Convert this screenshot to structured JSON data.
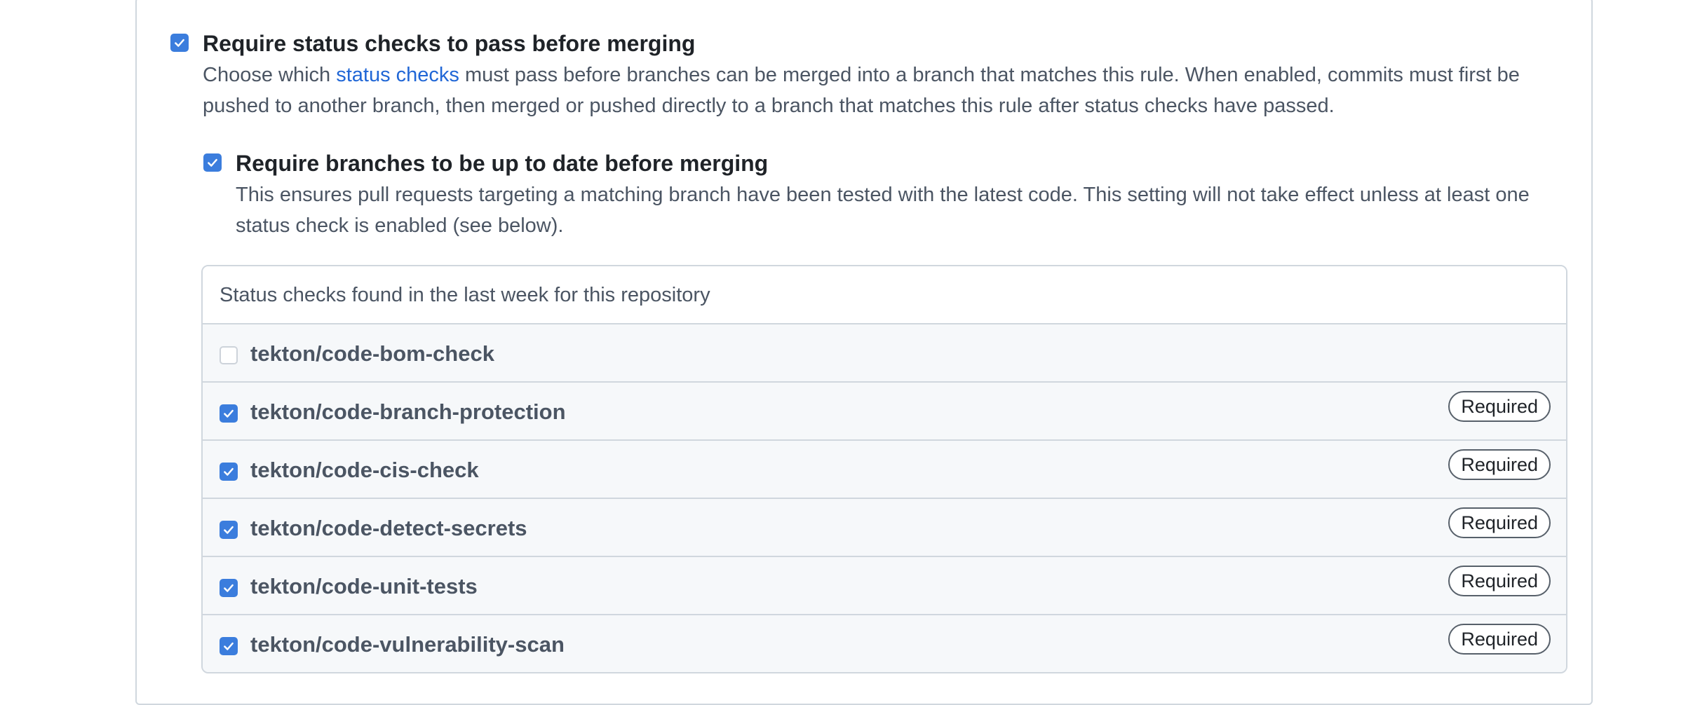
{
  "status_checks_option": {
    "title": "Require status checks to pass before merging",
    "checked": true,
    "desc_before_link": "Choose which ",
    "link_text": "status checks",
    "desc_after_link": " must pass before branches can be merged into a branch that matches this rule. When enabled, commits must first be pushed to another branch, then merged or pushed directly to a branch that matches this rule after status checks have passed."
  },
  "up_to_date_option": {
    "title": "Require branches to be up to date before merging",
    "checked": true,
    "description": "This ensures pull requests targeting a matching branch have been tested with the latest code. This setting will not take effect unless at least one status check is enabled (see below)."
  },
  "checks_list": {
    "header": "Status checks found in the last week for this repository",
    "required_label": "Required",
    "items": [
      {
        "name": "tekton/code-bom-check",
        "checked": false
      },
      {
        "name": "tekton/code-branch-protection",
        "checked": true
      },
      {
        "name": "tekton/code-cis-check",
        "checked": true
      },
      {
        "name": "tekton/code-detect-secrets",
        "checked": true
      },
      {
        "name": "tekton/code-unit-tests",
        "checked": true
      },
      {
        "name": "tekton/code-vulnerability-scan",
        "checked": true
      }
    ]
  },
  "colors": {
    "accent": "#3b7ddd",
    "link": "#2167d6",
    "border": "#d0d7de",
    "row_bg": "#f6f8fa"
  }
}
